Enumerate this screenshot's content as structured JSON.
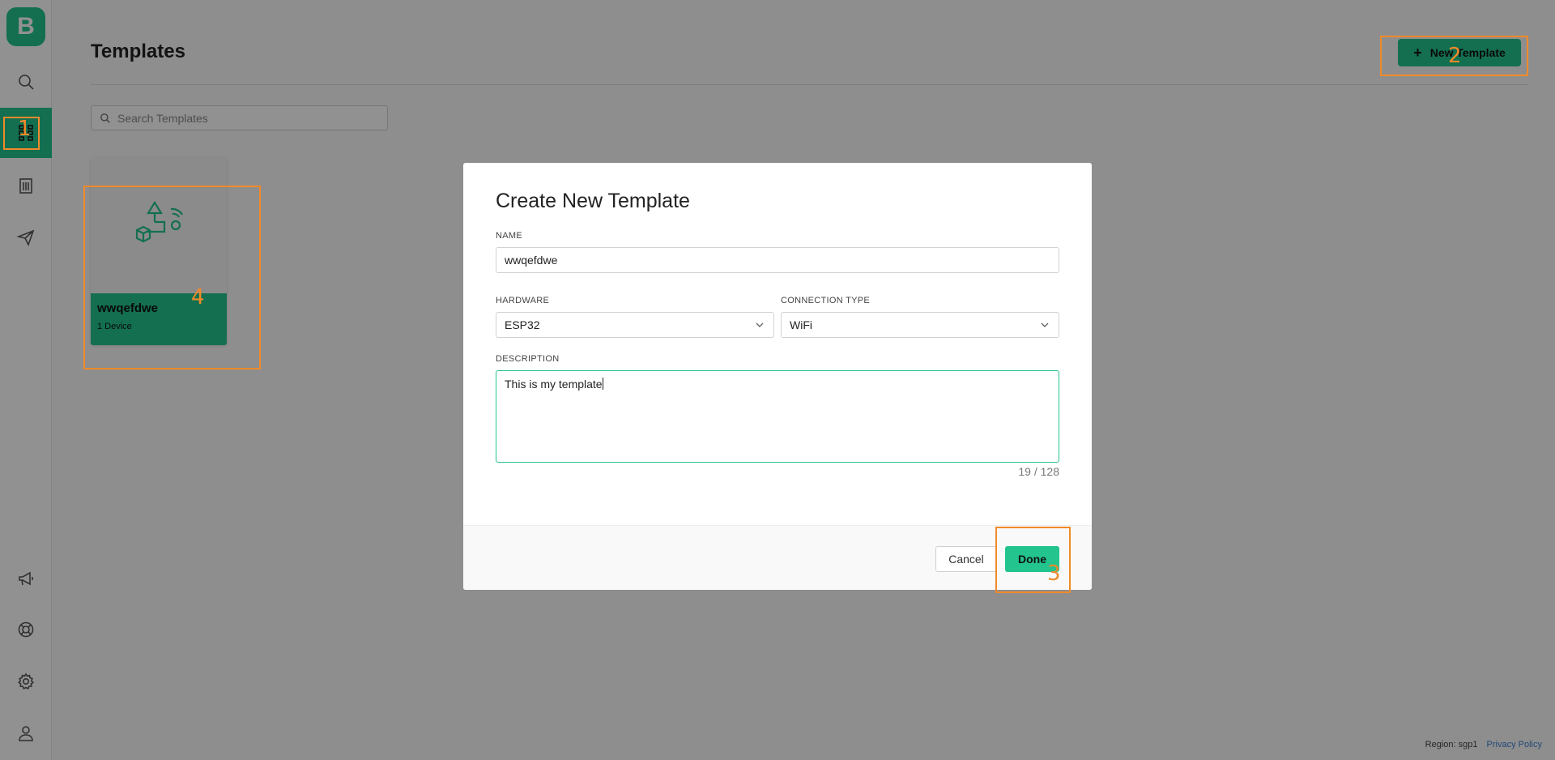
{
  "app": {
    "logo_letter": "B"
  },
  "sidebar": {
    "items": [
      {
        "name": "search",
        "icon": "search-icon"
      },
      {
        "name": "templates",
        "icon": "templates-icon",
        "active": true
      },
      {
        "name": "organizations",
        "icon": "building-icon"
      },
      {
        "name": "messages",
        "icon": "send-icon"
      },
      {
        "name": "announcements",
        "icon": "megaphone-icon"
      },
      {
        "name": "help",
        "icon": "lifebuoy-icon"
      },
      {
        "name": "settings",
        "icon": "gear-icon"
      },
      {
        "name": "account",
        "icon": "user-icon"
      }
    ]
  },
  "page": {
    "title": "Templates",
    "new_button_label": "New Template",
    "search_placeholder": "Search Templates"
  },
  "cards": [
    {
      "name": "wwqefdwe",
      "devices": "1 Device"
    }
  ],
  "footer": {
    "region": "Region: sgp1",
    "privacy": "Privacy Policy"
  },
  "modal": {
    "title": "Create New Template",
    "name_label": "NAME",
    "name_value": "wwqefdwe",
    "hardware_label": "HARDWARE",
    "hardware_value": "ESP32",
    "connection_label": "CONNECTION TYPE",
    "connection_value": "WiFi",
    "description_label": "DESCRIPTION",
    "description_value": "This is my template",
    "counter": "19 / 128",
    "cancel_label": "Cancel",
    "done_label": "Done"
  },
  "annotations": [
    "1",
    "2",
    "3",
    "4"
  ],
  "colors": {
    "accent": "#23c48e",
    "annotation": "#f08a2a",
    "link": "#3f7fd0"
  }
}
